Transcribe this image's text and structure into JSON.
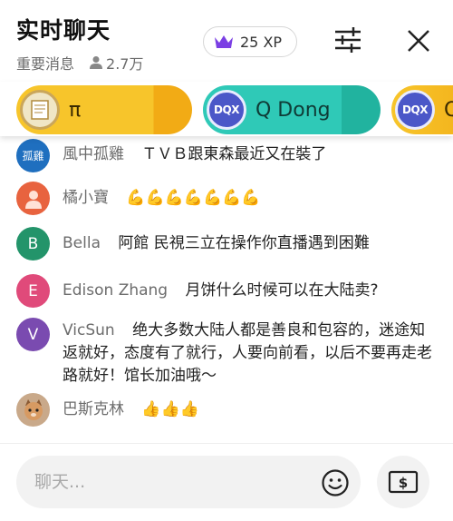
{
  "header": {
    "title": "实时聊天",
    "category": "重要消息",
    "viewers": "2.7万",
    "xp": "25 XP"
  },
  "chips": [
    {
      "label": "π",
      "avatar": "document"
    },
    {
      "label": "Q Dong",
      "avatar_text": "DQX"
    },
    {
      "label": "Q",
      "avatar_text": "DQX"
    }
  ],
  "messages": [
    {
      "name": "風中孤雞",
      "text": "ＴＶＢ跟東森最近又在裝了",
      "avatar_text": "孤雞",
      "avatar_color": "#1f6fbf"
    },
    {
      "name": "橘小寶",
      "text": "💪💪💪💪💪💪💪",
      "avatar_color": "#e8633f"
    },
    {
      "name": "Bella",
      "text": "阿館 民視三立在操作你直播遇到困難",
      "avatar_text": "B",
      "avatar_color": "#23946a"
    },
    {
      "name": "Edison Zhang",
      "text": "月饼什么时候可以在大陆卖?",
      "avatar_text": "E",
      "avatar_color": "#e04a7a"
    },
    {
      "name": "VicSun",
      "text": "绝大多数大陆人都是善良和包容的，迷途知返就好，态度有了就行，人要向前看，以后不要再走老路就好！馆长加油哦～",
      "avatar_text": "V",
      "avatar_color": "#7a4bb0"
    },
    {
      "name": "巴斯克林",
      "text": "👍👍👍",
      "avatar_color": "#c9a98a"
    }
  ],
  "input": {
    "placeholder": "聊天..."
  },
  "colors": {
    "chip_yellow": "#f7c52b",
    "chip_teal": "#2fc9b7",
    "crown": "#7b3fe4"
  },
  "icons": [
    "person-icon",
    "crown-icon",
    "settings-icon",
    "close-icon",
    "emoji-icon",
    "cash-icon"
  ]
}
